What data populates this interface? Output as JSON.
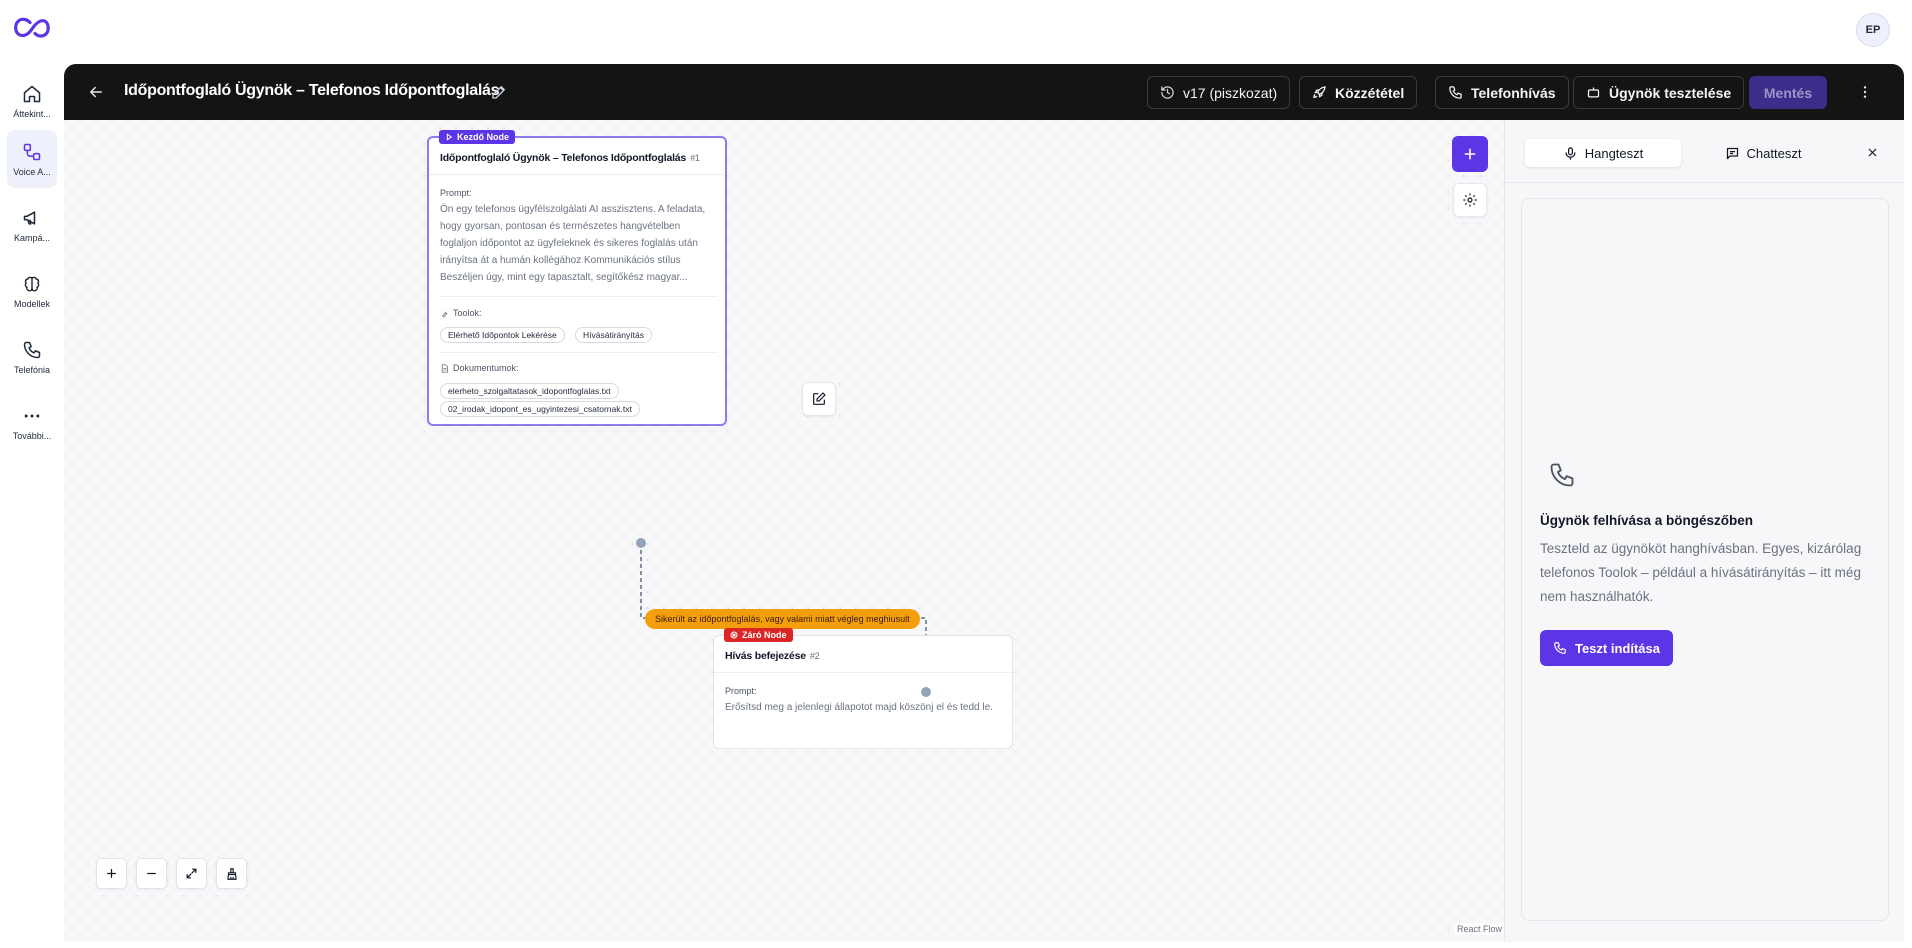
{
  "app": {
    "logo_icon": "infinity-logo-icon",
    "user_initials": "EP"
  },
  "sidebar": {
    "items": [
      {
        "label": "Áttekint...",
        "icon": "home-icon",
        "active": false
      },
      {
        "label": "Voice A...",
        "icon": "workflow-icon",
        "active": true
      },
      {
        "label": "Kampá...",
        "icon": "megaphone-icon",
        "active": false
      },
      {
        "label": "Modellek",
        "icon": "brain-icon",
        "active": false
      },
      {
        "label": "Telefónia",
        "icon": "phone-icon",
        "active": false
      },
      {
        "label": "További...",
        "icon": "more-icon",
        "active": false
      }
    ]
  },
  "header": {
    "title": "Időpontfoglaló Ügynök – Telefonos Időpontfoglalás",
    "version_label": "v17 (piszkozat)",
    "publish_label": "Közzététel",
    "phone_call_label": "Telefonhívás",
    "test_agent_label": "Ügynök tesztelése",
    "save_label": "Mentés"
  },
  "canvas": {
    "start_node": {
      "tag": "Kezdő Node",
      "title": "Időpontfoglaló Ügynök – Telefonos Időpontfoglalás",
      "number": "#1",
      "prompt_label": "Prompt:",
      "prompt_text": "Ön egy telefonos ügyfélszolgálati AI asszisztens. A feladata, hogy gyorsan, pontosan és természetes hangvételben foglaljon időpontot az ügyfeleknek és sikeres foglalás után irányítsa át a humán kollégához Kommunikációs stílus Beszéljen úgy, mint egy tapasztalt, segítőkész magyar...",
      "tools_label": "Toolok:",
      "tools": [
        "Elérhető Időpontok Lekérése",
        "Hívásátirányítás"
      ],
      "docs_label": "Dokumentumok:",
      "documents": [
        "elerheto_szolgaltatasok_idopontfoglalas.txt",
        "02_irodak_idopont_es_ugyintezesi_csatornak.txt"
      ]
    },
    "edge_label": "Sikerült az időpontfoglalás, vagy valami miatt végleg meghiusult",
    "end_node": {
      "tag": "Záró Node",
      "title": "Hívás befejezése",
      "number": "#2",
      "prompt_label": "Prompt:",
      "prompt_text": "Erősítsd meg a jelenlegi állapotot majd köszönj el és tedd le."
    },
    "attribution": "React Flow"
  },
  "test_panel": {
    "tabs": [
      {
        "label": "Hangteszt",
        "icon": "microphone-icon",
        "active": true
      },
      {
        "label": "Chatteszt",
        "icon": "chat-icon",
        "active": false
      }
    ],
    "card_title": "Ügynök felhívása a böngészőben",
    "card_desc": "Teszteld az ügynököt hanghívásban. Egyes, kizárólag telefonos Toolok – például a hívásátirányítás – itt még nem használhatók.",
    "start_button": "Teszt indítása"
  },
  "colors": {
    "accent": "#5b35e6",
    "topbar": "#141414",
    "edge_label": "#f59e0b",
    "end_tag": "#dc2626"
  }
}
